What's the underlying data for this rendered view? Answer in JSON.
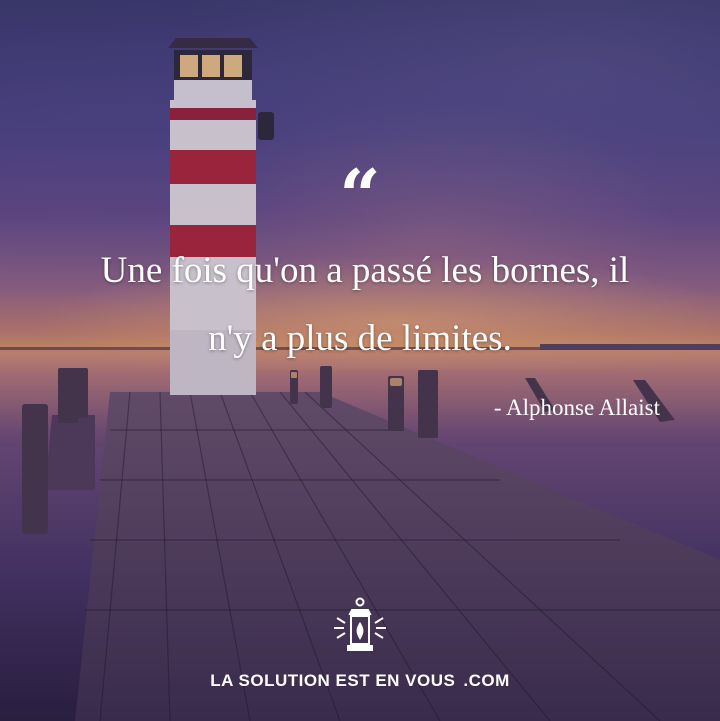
{
  "quote": {
    "mark": "“",
    "line1": "Une fois qu'on a passé les bornes, il",
    "line2": "n'y a plus de limites.",
    "author": "- Alphonse Allaist"
  },
  "brand": {
    "name": "LA SOLUTION EST EN VOUS",
    "suffix": ".COM",
    "icon": "lantern-icon"
  },
  "colors": {
    "text": "#ffffff",
    "lighthouse_red": "#b3263a"
  }
}
